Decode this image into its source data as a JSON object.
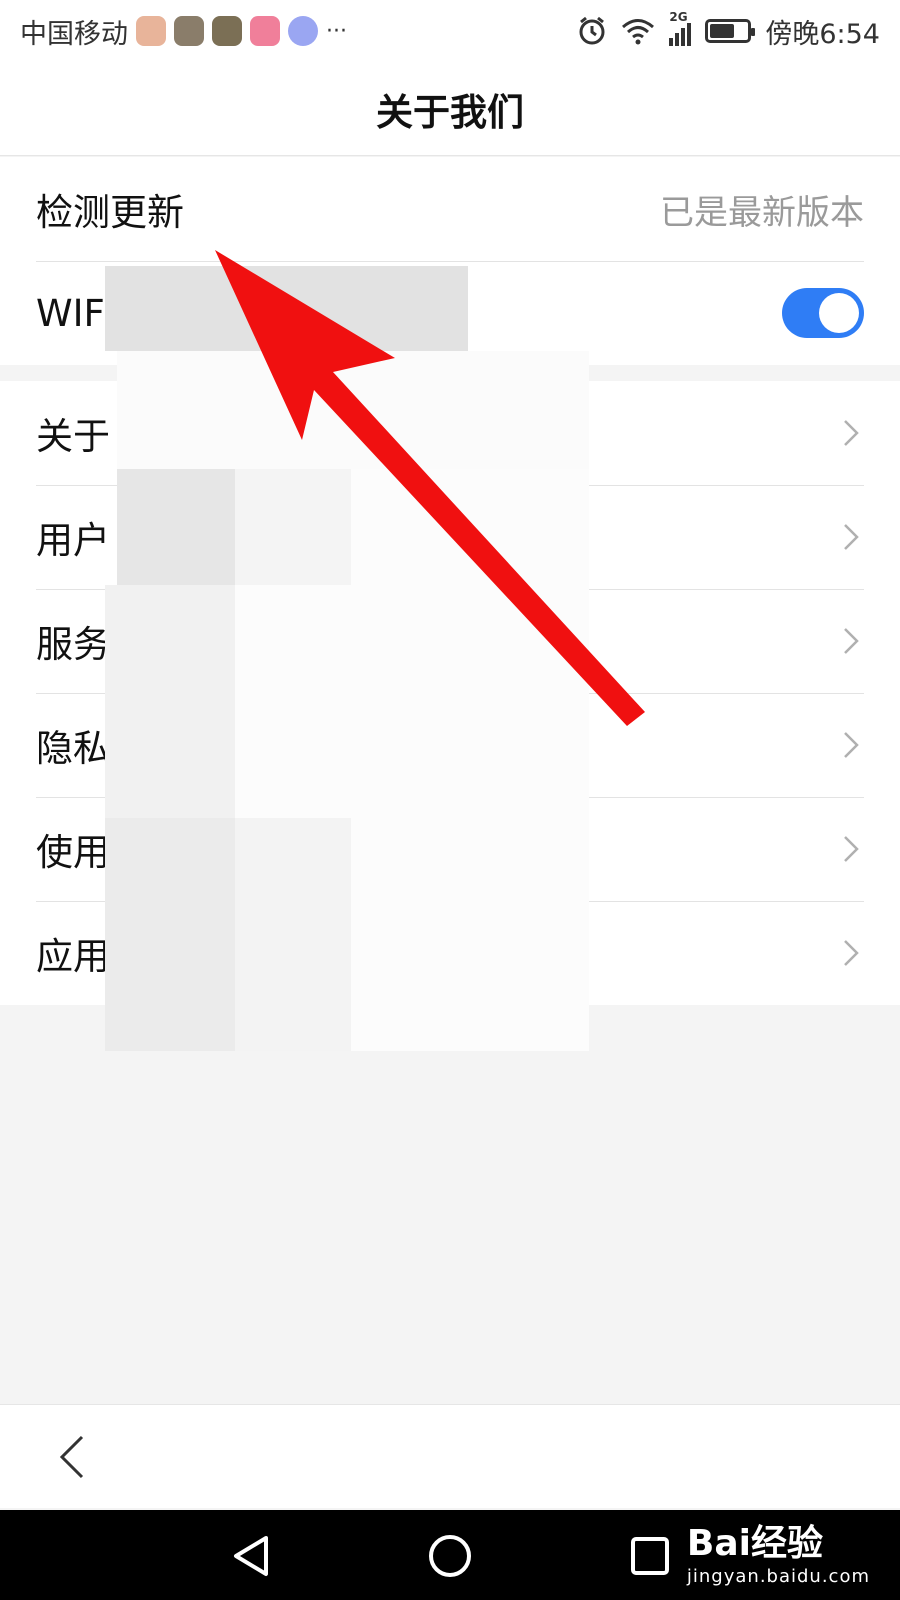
{
  "status_bar": {
    "carrier": "中国移动",
    "more": "···",
    "network": "2G",
    "time": "傍晚6:54",
    "icons": [
      "alarm-icon",
      "wifi-icon",
      "signal-icon",
      "battery-icon"
    ],
    "notification_icons": [
      "app-icon-1",
      "app-icon-2",
      "app-icon-3",
      "app-icon-4",
      "music-icon"
    ]
  },
  "header": {
    "title": "关于我们"
  },
  "settings": {
    "check_update": {
      "label": "检测更新",
      "value": "已是最新版本"
    },
    "wifi": {
      "label": "WIF",
      "enabled": true
    }
  },
  "list": {
    "items": [
      {
        "label": "关于"
      },
      {
        "label": "用户"
      },
      {
        "label": "服务"
      },
      {
        "label": "隐私"
      },
      {
        "label": "使用"
      },
      {
        "label": "应用"
      }
    ]
  },
  "navigation": {
    "back_icon": "chevron-left-icon"
  },
  "system_nav": {
    "buttons": [
      "back-triangle-icon",
      "home-circle-icon",
      "recents-square-icon"
    ]
  },
  "watermark": {
    "logo": "Bai经验",
    "url": "jingyan.baidu.com"
  },
  "colors": {
    "accent": "#2f7df5",
    "arrow": "#f01010",
    "background": "#f4f4f4"
  }
}
